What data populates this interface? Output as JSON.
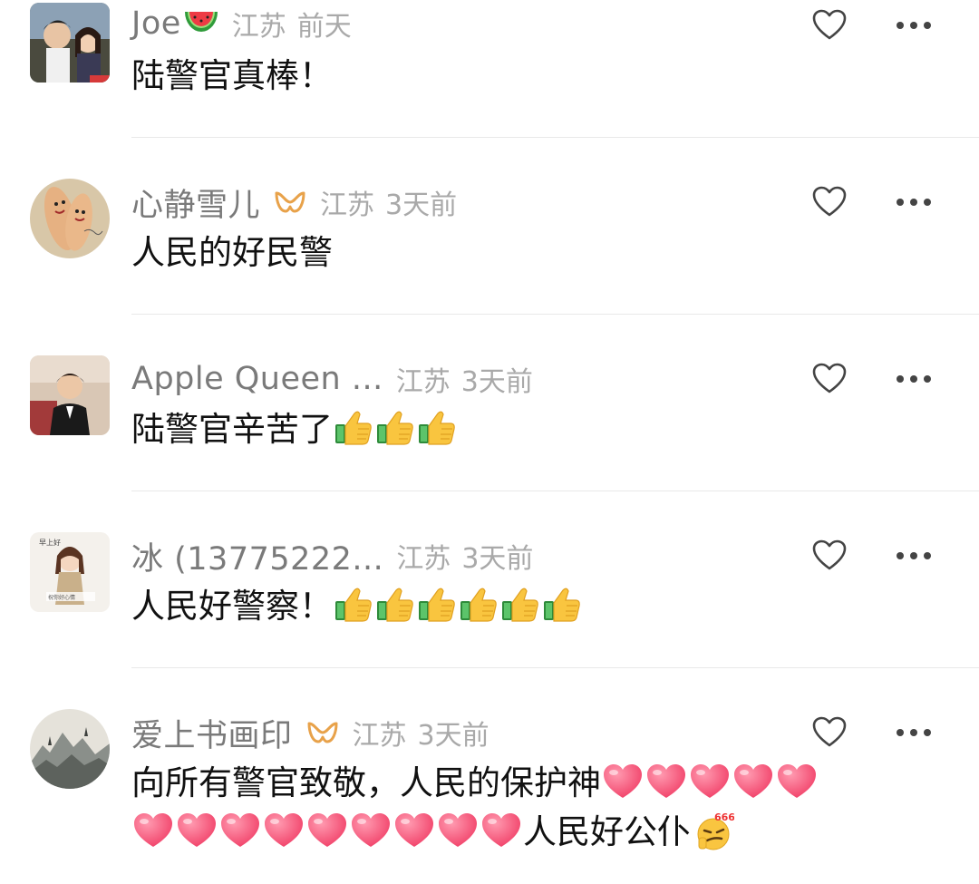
{
  "comments": [
    {
      "username": "Joe",
      "location": "江苏",
      "time": "前天",
      "text": "陆警官真棒！",
      "name_emoji": "watermelon"
    },
    {
      "username": "心静雪儿",
      "location": "江苏",
      "time": "3天前",
      "text": "人民的好民警",
      "vip_badge_icon": "vip-badge-icon"
    },
    {
      "username": "Apple Queen ...",
      "location": "江苏",
      "time": "3天前",
      "text": "陆警官辛苦了",
      "trailing_emoji": "thumbs-up",
      "trailing_emoji_count": 3
    },
    {
      "username": "冰 (13775222...",
      "location": "江苏",
      "time": "3天前",
      "text": "人民好警察！",
      "trailing_emoji": "thumbs-up",
      "trailing_emoji_count": 6
    },
    {
      "username": "爱上书画印",
      "location": "江苏",
      "time": "3天前",
      "text_line1": "向所有警官致敬，人民的保护神",
      "line1_hearts": 5,
      "line2_hearts": 9,
      "text_line2": "人民好公仆",
      "end_emoji": "666-smirk",
      "vip_badge_icon": "vip-badge-icon"
    }
  ],
  "colors": {
    "username": "#7a7a7a",
    "meta": "#a9a9a9",
    "text": "#111111",
    "badge": "#e8a24a",
    "divider": "#e8e8e8"
  },
  "avatar_images": {
    "avatar_1": "anime couple illustration",
    "avatar_2": "fingers with drawn faces",
    "avatar_3": "woman portrait",
    "avatar_4": "cartoon girl",
    "avatar_5": "ink landscape painting"
  }
}
